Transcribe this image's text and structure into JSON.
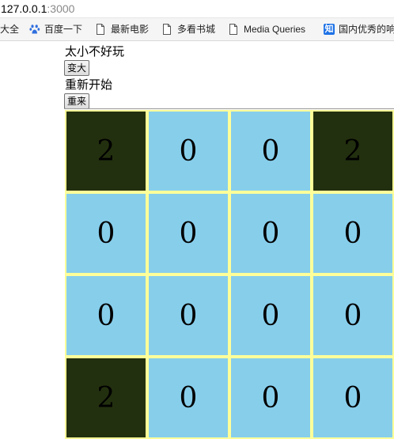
{
  "browser": {
    "address_host": "127.0.0.1",
    "address_port": ":3000",
    "bookmarks": [
      {
        "label": "大全",
        "icon": "none"
      },
      {
        "label": "百度一下",
        "icon": "baidu-paw-icon"
      },
      {
        "label": "最新电影",
        "icon": "page-icon"
      },
      {
        "label": "多看书城",
        "icon": "page-icon"
      },
      {
        "label": "Media Queries",
        "icon": "page-icon"
      },
      {
        "label": "国内优秀的响",
        "icon": "zhihu-icon"
      }
    ],
    "zhihu_glyph": "知"
  },
  "game": {
    "size_text": "太小不好玩",
    "enlarge_label": "变大",
    "restart_text": "重新开始",
    "restart_label": "重来",
    "tiles": [
      [
        "2",
        "0",
        "0",
        "2"
      ],
      [
        "0",
        "0",
        "0",
        "0"
      ],
      [
        "0",
        "0",
        "0",
        "0"
      ],
      [
        "2",
        "0",
        "0",
        "0"
      ]
    ]
  },
  "colors": {
    "tile_zero": "#87ceeb",
    "tile_two": "#23300f",
    "tile_two_text": "#000000",
    "board_gap": "#ffff99",
    "baidu_blue": "#2f6fde",
    "zhihu_blue": "#1e72e6"
  }
}
